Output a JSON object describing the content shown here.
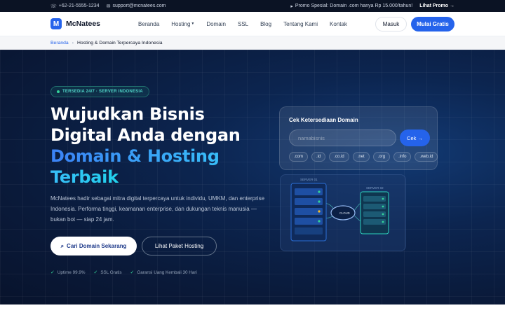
{
  "topbar": {
    "phone": "+62-21-5555-1234",
    "phone_icon": "phone-icon",
    "email": "support@mcnatees.com",
    "email_icon": "mail-icon",
    "promo_text": "Promo Spesial: Domain .com hanya Rp 15.000/tahun!",
    "promo_icon": "tag-icon",
    "promo_link": "Lihat Promo →"
  },
  "brand": {
    "logo_letter": "M",
    "name": "McNatees",
    "color": "#2563eb"
  },
  "nav": {
    "items": [
      "Beranda",
      "Hosting",
      "Domain",
      "SSL",
      "Blog",
      "Tentang Kami",
      "Kontak"
    ],
    "login": "Masuk",
    "signup": "Mulai Gratis"
  },
  "breadcrumb": {
    "home": "Beranda",
    "separator": "›",
    "current": "Hosting & Domain Terpercaya Indonesia"
  },
  "hero": {
    "badge": "TERSEDIA 24/7 · SERVER INDONESIA",
    "headline_line1": "Wujudkan Bisnis",
    "headline_line2": "Digital Anda dengan",
    "headline_line3": "Domain & Hosting",
    "headline_line4": "Terbaik",
    "description": "McNatees hadir sebagai mitra digital terpercaya untuk individu, UMKM, dan enterprise Indonesia. Performa tinggi, keamanan enterprise, dan dukungan teknis manusia — bukan bot — siap 24 jam.",
    "cta_primary": "Cari Domain Sekarang",
    "cta_primary_icon": "search-icon",
    "cta_secondary": "Lihat Paket Hosting",
    "features": [
      "Uptime 99.9%",
      "SSL Gratis",
      "Garansi Uang Kembali 30 Hari"
    ]
  },
  "domain_search": {
    "title": "Cek Ketersediaan Domain",
    "placeholder": "namabisnis",
    "button": "Cek →",
    "tlds": [
      ".com",
      ".id",
      ".co.id",
      ".net",
      ".org",
      ".info",
      ".web.id"
    ]
  },
  "diagram": {
    "server_left_label": "SERVER 01",
    "server_right_label": "SERVER 02",
    "cloud_label": "CLOUD"
  },
  "colors": {
    "accent": "#2563eb",
    "teal": "#4fd1c5",
    "status_green": "#34d399",
    "status_amber": "#fbbf24"
  }
}
